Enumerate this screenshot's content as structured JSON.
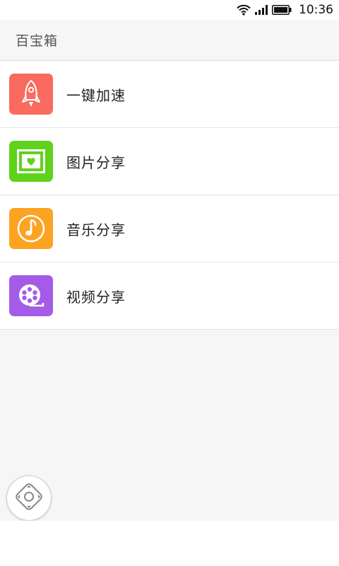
{
  "status_bar": {
    "time": "10:36",
    "icons": [
      "wifi-icon",
      "signal-icon",
      "battery-icon"
    ]
  },
  "header": {
    "title": "百宝箱"
  },
  "items": [
    {
      "label": "一键加速",
      "icon": "rocket-icon",
      "color": "#f96a5f"
    },
    {
      "label": "图片分享",
      "icon": "picture-icon",
      "color": "#5fd21b"
    },
    {
      "label": "音乐分享",
      "icon": "music-note-icon",
      "color": "#fca322"
    },
    {
      "label": "视频分享",
      "icon": "film-reel-icon",
      "color": "#a35be8"
    }
  ],
  "floating_button": {
    "icon": "dpad-icon"
  },
  "colors": {
    "page_background": "#f6f6f6",
    "header_text": "#555555"
  }
}
